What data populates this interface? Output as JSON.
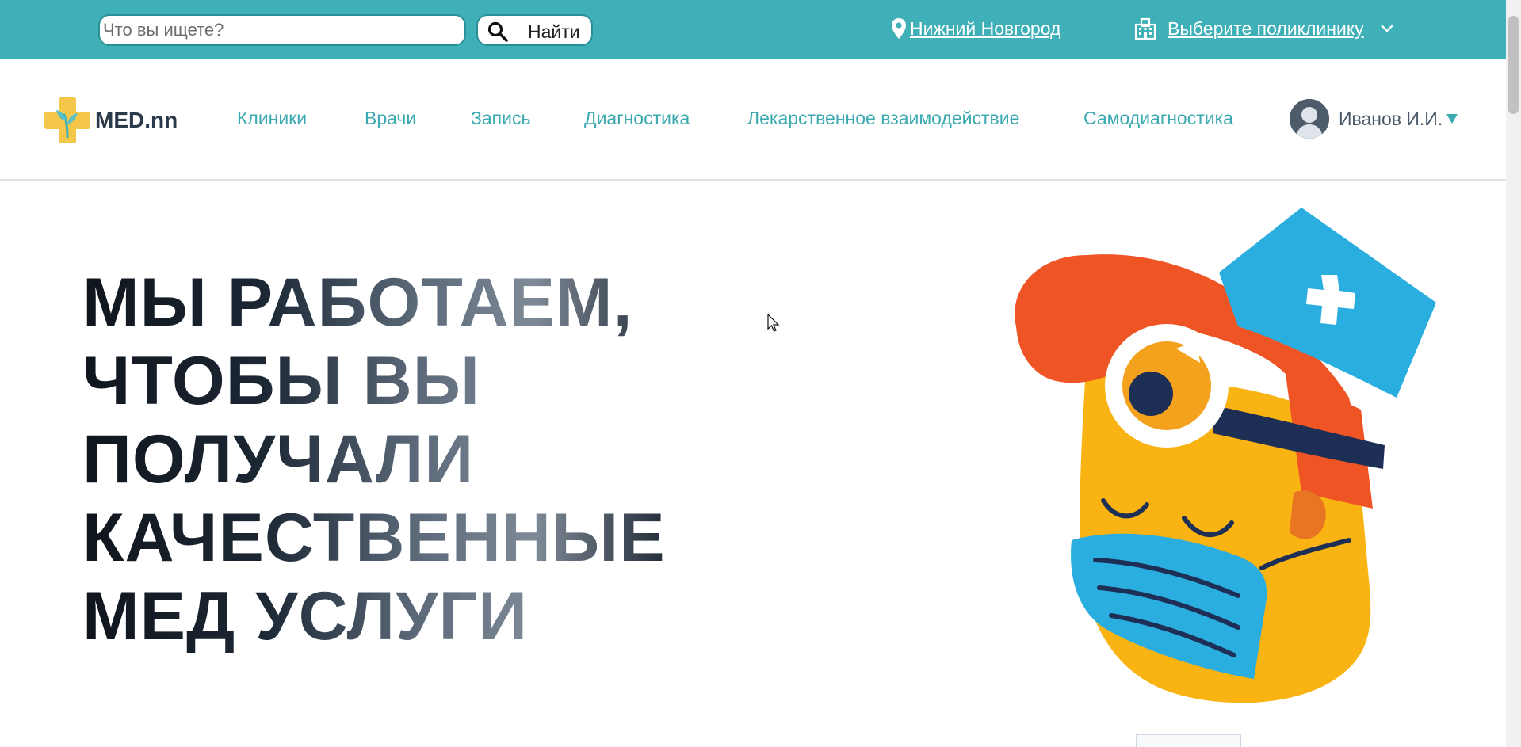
{
  "search": {
    "placeholder": "Что вы ищете?",
    "button_label": "Найти"
  },
  "location": {
    "city": "Нижний Новгород",
    "clinic_select_label": "Выберите поликлинику"
  },
  "header": {
    "logo_text": "MED.nn",
    "nav": [
      {
        "label": "Клиники"
      },
      {
        "label": "Врачи"
      },
      {
        "label": "Запись"
      },
      {
        "label": "Диагностика"
      },
      {
        "label": "Лекарственное взаимодействие"
      },
      {
        "label": "Самодиагностика"
      }
    ],
    "user_name": "Иванов И.И."
  },
  "hero": {
    "lines": [
      "МЫ РАБОТАЕМ,",
      "ЧТОБЫ ВЫ",
      "ПОЛУЧАЛИ",
      "КАЧЕСТВЕННЫЕ",
      "МЕД УСЛУГИ"
    ]
  },
  "colors": {
    "topbar": "#3fb0b8",
    "nav_link": "#3aa9b0",
    "hero_text": "#16202c"
  },
  "icons": [
    "search-icon",
    "location-pin-icon",
    "clinic-building-icon",
    "chevron-down-icon",
    "avatar-icon",
    "caret-down-icon"
  ]
}
